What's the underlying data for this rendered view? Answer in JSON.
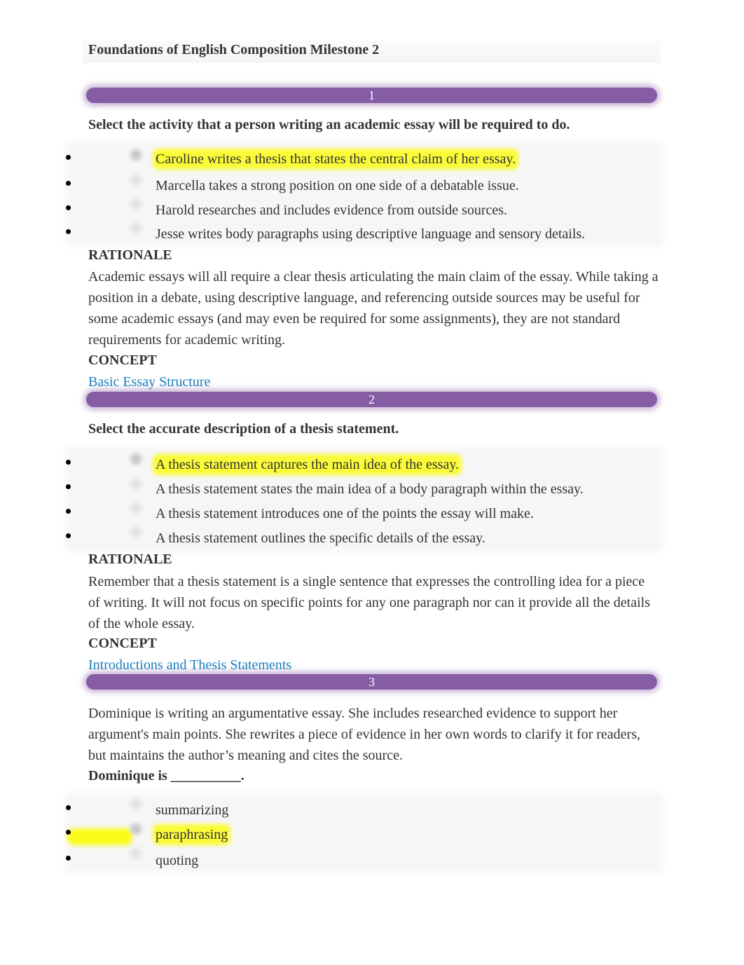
{
  "document": {
    "title": "Foundations of English Composition Milestone 2"
  },
  "labels": {
    "rationale": "RATIONALE",
    "concept": "CONCEPT"
  },
  "colors": {
    "question_bar": "#865da4",
    "highlight": "#fbfb3a",
    "link": "#1a7fbe",
    "text": "#333333"
  },
  "questions": [
    {
      "number": "1",
      "prompt": "Select the activity that a person writing an academic essay will be required to do.",
      "options": [
        {
          "text": "Caroline writes a thesis that states the central claim of her essay.",
          "selected": true
        },
        {
          "text": "Marcella takes a strong position on one side of a debatable issue.",
          "selected": false
        },
        {
          "text": "Harold researches and includes evidence from outside sources.",
          "selected": false
        },
        {
          "text": "Jesse writes body paragraphs using descriptive language and sensory details.",
          "selected": false
        }
      ],
      "rationale": "Academic essays will all require a clear thesis articulating the main claim of the essay. While taking a position in a debate, using descriptive language, and referencing outside sources may be useful for some academic essays (and may even be required for some assignments), they are not standard requirements for academic writing.",
      "concept": "Basic Essay Structure"
    },
    {
      "number": "2",
      "prompt": "Select the accurate description of a thesis statement.",
      "options": [
        {
          "text": "A thesis statement captures the main idea of the essay.",
          "selected": true
        },
        {
          "text": "A thesis statement states the main idea of a body paragraph within the essay.",
          "selected": false
        },
        {
          "text": "A thesis statement introduces one of the points the essay will make.",
          "selected": false
        },
        {
          "text": "A thesis statement outlines the specific details of the essay.",
          "selected": false
        }
      ],
      "rationale": "Remember that a thesis statement is a single sentence that expresses the controlling idea for a piece of writing. It will not focus on specific points for any one paragraph nor can it provide all the details of the whole essay.",
      "concept": "Introductions and Thesis Statements"
    },
    {
      "number": "3",
      "passage": "Dominique is writing an argumentative essay. She includes researched evidence to support her argument's main points. She rewrites a piece of evidence in her own words to clarify it for readers, but maintains the author’s meaning and cites the source.",
      "prompt": "Dominique is __________.",
      "options": [
        {
          "text": "summarizing",
          "selected": false
        },
        {
          "text": "paraphrasing",
          "selected": true
        },
        {
          "text": "quoting",
          "selected": false
        }
      ]
    }
  ]
}
